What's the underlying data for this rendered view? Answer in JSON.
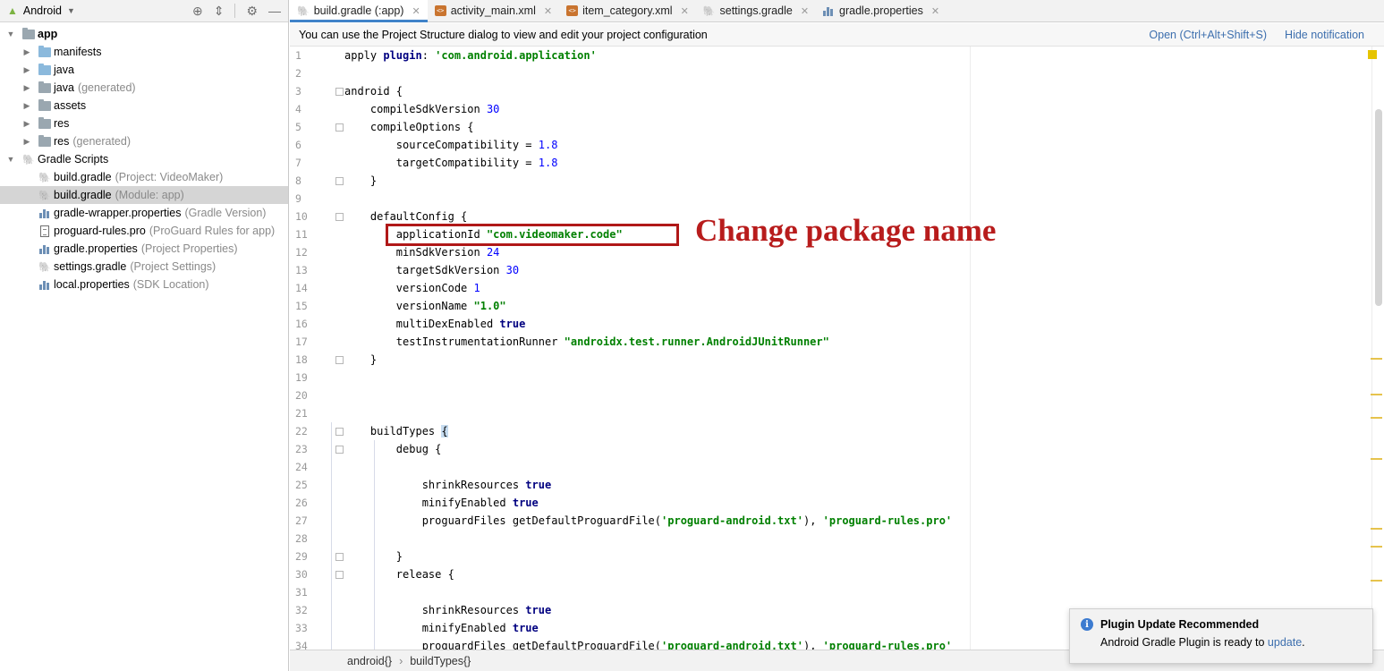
{
  "project_panel": {
    "view_label": "Android",
    "tree": [
      {
        "label": "app",
        "secondary": "",
        "indent": 0,
        "arrow": "▼",
        "icon": "app-folder-icon",
        "bold": true
      },
      {
        "label": "manifests",
        "secondary": "",
        "indent": 1,
        "arrow": "▶",
        "icon": "folder-icon"
      },
      {
        "label": "java",
        "secondary": "",
        "indent": 1,
        "arrow": "▶",
        "icon": "folder-icon"
      },
      {
        "label": "java",
        "secondary": "(generated)",
        "indent": 1,
        "arrow": "▶",
        "icon": "generated-folder-icon"
      },
      {
        "label": "assets",
        "secondary": "",
        "indent": 1,
        "arrow": "▶",
        "icon": "resources-folder-icon"
      },
      {
        "label": "res",
        "secondary": "",
        "indent": 1,
        "arrow": "▶",
        "icon": "resources-folder-icon"
      },
      {
        "label": "res",
        "secondary": "(generated)",
        "indent": 1,
        "arrow": "▶",
        "icon": "resources-folder-icon"
      },
      {
        "label": "Gradle Scripts",
        "secondary": "",
        "indent": 0,
        "arrow": "▼",
        "icon": "gradle-icon"
      },
      {
        "label": "build.gradle",
        "secondary": "(Project: VideoMaker)",
        "indent": 1,
        "arrow": "",
        "icon": "gradle-icon"
      },
      {
        "label": "build.gradle",
        "secondary": "(Module: app)",
        "indent": 1,
        "arrow": "",
        "icon": "gradle-icon",
        "selected": true
      },
      {
        "label": "gradle-wrapper.properties",
        "secondary": "(Gradle Version)",
        "indent": 1,
        "arrow": "",
        "icon": "properties-icon"
      },
      {
        "label": "proguard-rules.pro",
        "secondary": "(ProGuard Rules for app)",
        "indent": 1,
        "arrow": "",
        "icon": "text-file-icon"
      },
      {
        "label": "gradle.properties",
        "secondary": "(Project Properties)",
        "indent": 1,
        "arrow": "",
        "icon": "properties-icon"
      },
      {
        "label": "settings.gradle",
        "secondary": "(Project Settings)",
        "indent": 1,
        "arrow": "",
        "icon": "gradle-icon"
      },
      {
        "label": "local.properties",
        "secondary": "(SDK Location)",
        "indent": 1,
        "arrow": "",
        "icon": "properties-icon"
      }
    ]
  },
  "tabs": [
    {
      "label": "build.gradle (:app)",
      "icon": "gradle-icon",
      "active": true
    },
    {
      "label": "activity_main.xml",
      "icon": "xml-icon"
    },
    {
      "label": "item_category.xml",
      "icon": "xml-icon"
    },
    {
      "label": "settings.gradle",
      "icon": "gradle-icon"
    },
    {
      "label": "gradle.properties",
      "icon": "properties-icon"
    }
  ],
  "notification": {
    "message": "You can use the Project Structure dialog to view and edit your project configuration",
    "open_link": "Open (Ctrl+Alt+Shift+S)",
    "hide_link": "Hide notification"
  },
  "code_lines": [
    [
      {
        "t": "apply "
      },
      {
        "t": "plugin",
        "c": "kw"
      },
      {
        "t": ": "
      },
      {
        "t": "'com.android.application'",
        "c": "str"
      }
    ],
    [],
    [
      {
        "t": "android {"
      }
    ],
    [
      {
        "t": "    compileSdkVersion "
      },
      {
        "t": "30",
        "c": "num"
      }
    ],
    [
      {
        "t": "    compileOptions {"
      }
    ],
    [
      {
        "t": "        sourceCompatibility = "
      },
      {
        "t": "1.8",
        "c": "num"
      }
    ],
    [
      {
        "t": "        targetCompatibility = "
      },
      {
        "t": "1.8",
        "c": "num"
      }
    ],
    [
      {
        "t": "    }"
      }
    ],
    [],
    [
      {
        "t": "    defaultConfig {"
      }
    ],
    [
      {
        "t": "        applicationId "
      },
      {
        "t": "\"com.videomaker.code\"",
        "c": "str"
      }
    ],
    [
      {
        "t": "        minSdkVersion "
      },
      {
        "t": "24",
        "c": "num"
      }
    ],
    [
      {
        "t": "        targetSdkVersion "
      },
      {
        "t": "30",
        "c": "num"
      }
    ],
    [
      {
        "t": "        versionCode "
      },
      {
        "t": "1",
        "c": "num"
      }
    ],
    [
      {
        "t": "        versionName "
      },
      {
        "t": "\"1.0\"",
        "c": "str"
      }
    ],
    [
      {
        "t": "        multiDexEnabled "
      },
      {
        "t": "true",
        "c": "kw"
      }
    ],
    [
      {
        "t": "        testInstrumentationRunner "
      },
      {
        "t": "\"androidx.test.runner.AndroidJUnitRunner\"",
        "c": "str"
      }
    ],
    [
      {
        "t": "    }"
      }
    ],
    [],
    [],
    [],
    [
      {
        "t": "    buildTypes "
      },
      {
        "t": "{",
        "c": "brace-hl"
      }
    ],
    [
      {
        "t": "        debug {"
      }
    ],
    [],
    [
      {
        "t": "            shrinkResources "
      },
      {
        "t": "true",
        "c": "kw"
      }
    ],
    [
      {
        "t": "            minifyEnabled "
      },
      {
        "t": "true",
        "c": "kw"
      }
    ],
    [
      {
        "t": "            proguardFiles getDefaultProguardFile("
      },
      {
        "t": "'proguard-android.txt'",
        "c": "str"
      },
      {
        "t": "), "
      },
      {
        "t": "'proguard-rules.pro'",
        "c": "str"
      }
    ],
    [],
    [
      {
        "t": "        }"
      }
    ],
    [
      {
        "t": "        release {"
      }
    ],
    [],
    [
      {
        "t": "            shrinkResources "
      },
      {
        "t": "true",
        "c": "kw"
      }
    ],
    [
      {
        "t": "            minifyEnabled "
      },
      {
        "t": "true",
        "c": "kw"
      }
    ],
    [
      {
        "t": "            proguardFiles getDefaultProguardFile("
      },
      {
        "t": "'proguard-android.txt'",
        "c": "str"
      },
      {
        "t": "), "
      },
      {
        "t": "'proguard-rules.pro'",
        "c": "str"
      }
    ]
  ],
  "fold_lines": [
    3,
    5,
    8,
    10,
    18,
    22,
    23,
    29,
    30
  ],
  "annotation": {
    "text": "Change package name",
    "color": "#b81c1c"
  },
  "breadcrumb": [
    "android{}",
    "buildTypes{}"
  ],
  "balloon": {
    "title": "Plugin Update Recommended",
    "body_prefix": "Android Gradle Plugin is ready to ",
    "body_link": "update",
    "body_suffix": "."
  },
  "colors": {
    "accent": "#4083c9",
    "link": "#3d6fae",
    "annotation": "#b81c1c",
    "keyword": "#000080",
    "string": "#008000",
    "number": "#0000ff"
  }
}
